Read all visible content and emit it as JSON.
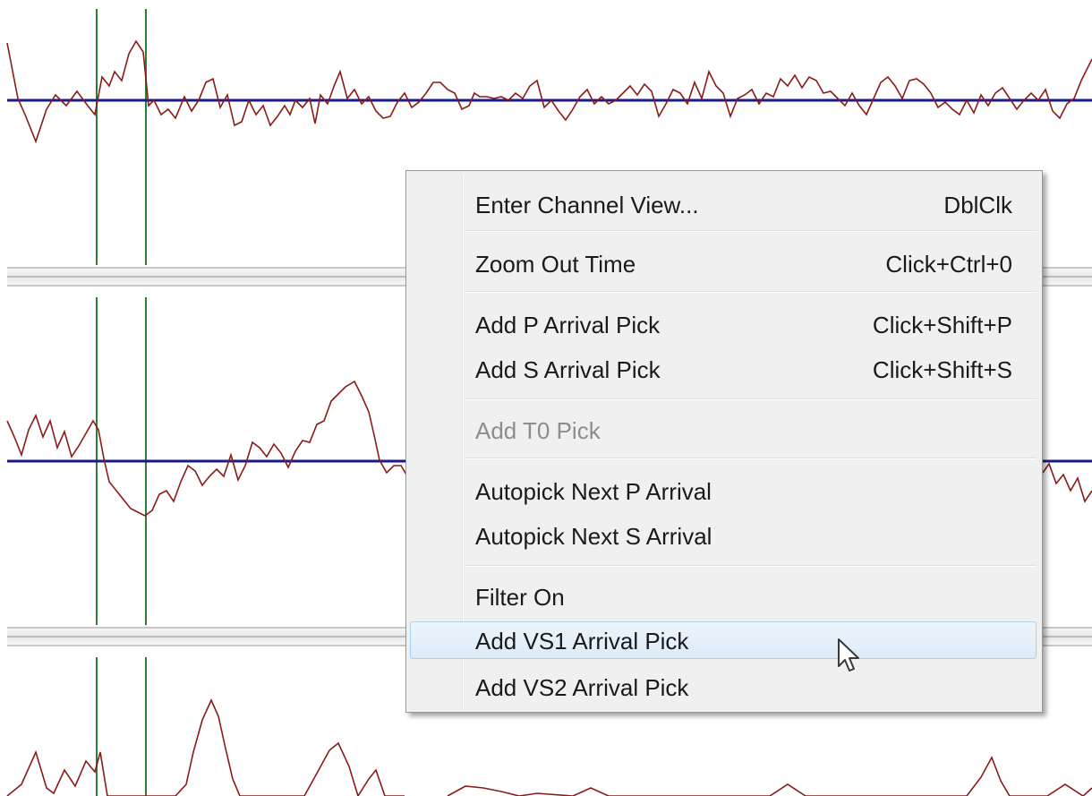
{
  "colors": {
    "waveform": "#8b1a1a",
    "baseline": "#1a1a8a",
    "pick_marker": "#2e7d32"
  },
  "context_menu": {
    "items": [
      {
        "label": "Enter Channel View...",
        "shortcut": "DblClk",
        "enabled": true,
        "highlighted": false
      },
      {
        "label": "Zoom Out Time",
        "shortcut": "Click+Ctrl+0",
        "enabled": true,
        "highlighted": false
      },
      {
        "label": "Add P Arrival Pick",
        "shortcut": "Click+Shift+P",
        "enabled": true,
        "highlighted": false
      },
      {
        "label": "Add S Arrival Pick",
        "shortcut": "Click+Shift+S",
        "enabled": true,
        "highlighted": false
      },
      {
        "label": "Add T0 Pick",
        "shortcut": "",
        "enabled": false,
        "highlighted": false
      },
      {
        "label": "Autopick Next P Arrival",
        "shortcut": "",
        "enabled": true,
        "highlighted": false
      },
      {
        "label": "Autopick Next S Arrival",
        "shortcut": "",
        "enabled": true,
        "highlighted": false
      },
      {
        "label": "Filter On",
        "shortcut": "",
        "enabled": true,
        "highlighted": false
      },
      {
        "label": "Add VS1 Arrival Pick",
        "shortcut": "",
        "enabled": true,
        "highlighted": true
      },
      {
        "label": "Add VS2 Arrival Pick",
        "shortcut": "",
        "enabled": true,
        "highlighted": false
      }
    ]
  },
  "cursor": "arrow-pointer-icon"
}
